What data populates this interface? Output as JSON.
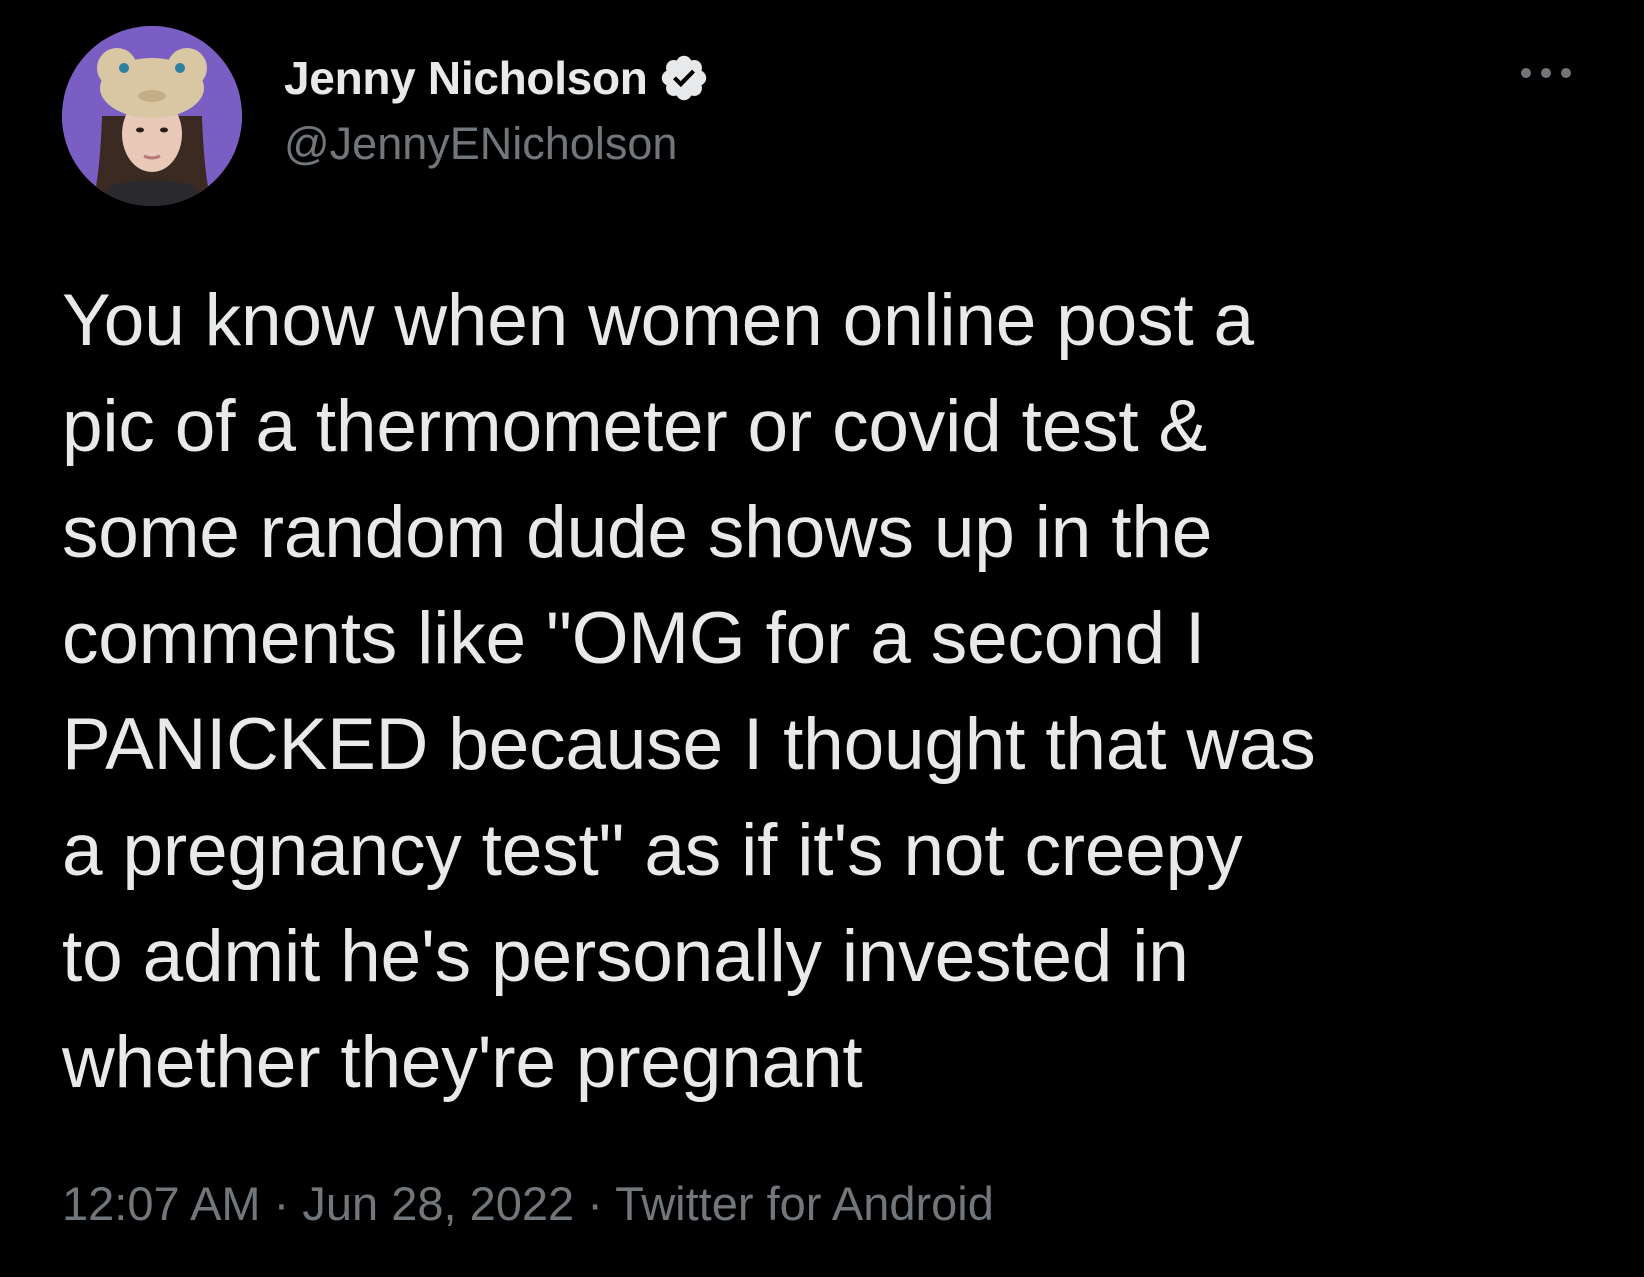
{
  "author": {
    "display_name": "Jenny Nicholson",
    "handle": "@JennyENicholson",
    "verified_icon": "verified-badge-icon",
    "avatar_icon": "profile-avatar"
  },
  "menu": {
    "more_icon": "more-options-icon"
  },
  "tweet": {
    "text": "You know when women online post a\npic of a thermometer or covid test &\nsome random dude shows up in the\ncomments like \"OMG for a second I\nPANICKED because I thought that was\na pregnancy test\" as if it's not creepy\nto admit he's personally invested in\nwhether they're pregnant",
    "time": "12:07 AM",
    "separator": "·",
    "date": "Jun 28, 2022",
    "source": "Twitter for Android"
  },
  "colors": {
    "background": "#000000",
    "primary_text": "#e7e9ea",
    "secondary_text": "#71767b",
    "avatar_bg": "#7a5cc2"
  }
}
